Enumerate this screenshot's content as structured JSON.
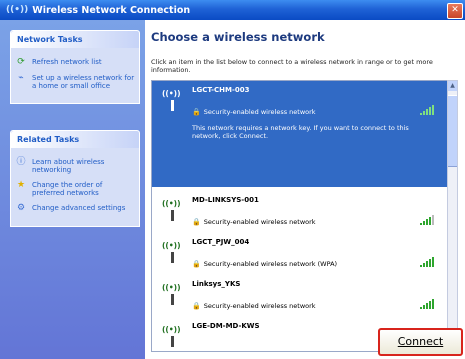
{
  "window": {
    "title": "Wireless Network Connection",
    "app_icon": "wireless-icon"
  },
  "sidebar": {
    "network_tasks": {
      "header": "Network Tasks",
      "items": [
        {
          "label": "Refresh network list",
          "icon": "refresh-icon"
        },
        {
          "label": "Set up a wireless network for a home or small office",
          "icon": "setup-wireless-icon"
        }
      ]
    },
    "related_tasks": {
      "header": "Related Tasks",
      "items": [
        {
          "label": "Learn about wireless networking",
          "icon": "info-icon"
        },
        {
          "label": "Change the order of preferred networks",
          "icon": "star-icon"
        },
        {
          "label": "Change advanced settings",
          "icon": "settings-icon"
        }
      ]
    }
  },
  "main": {
    "heading": "Choose a wireless network",
    "intro": "Click an item in the list below to connect to a wireless network in range or to get more information.",
    "networks": [
      {
        "name": "LGCT-CHM-003",
        "security": "Security-enabled wireless network",
        "description": "This network requires a network key. If you want to connect to this network, click Connect.",
        "selected": true
      },
      {
        "name": "MD-LINKSYS-001",
        "security": "Security-enabled wireless network",
        "selected": false
      },
      {
        "name": "LGCT_PJW_004",
        "security": "Security-enabled wireless network (WPA)",
        "selected": false
      },
      {
        "name": "Linksys_YKS",
        "security": "Security-enabled wireless network",
        "selected": false
      },
      {
        "name": "LGE-DM-MD-KWS",
        "security": "",
        "selected": false
      }
    ],
    "connect_button": "Connect"
  },
  "colors": {
    "selected_row": "#316ac5",
    "signal": "#2ea62e",
    "highlight_border": "#d8241c"
  }
}
